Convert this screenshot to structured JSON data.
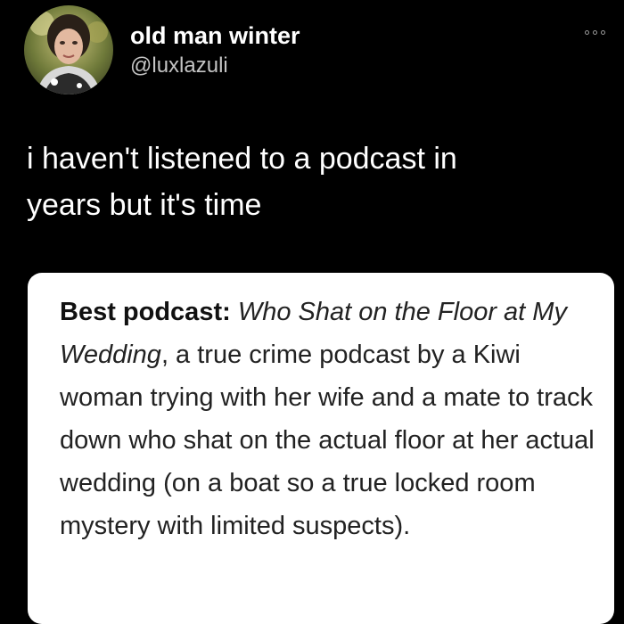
{
  "author": {
    "display_name": "old man winter",
    "handle": "@luxlazuli",
    "avatar_icon": "profile-photo"
  },
  "more_icon": "more-options-icon",
  "tweet": {
    "text_line_1": "i haven't listened to a podcast in",
    "text_line_2": "years but it's time"
  },
  "card": {
    "label": "Best podcast:",
    "title": "Who Shat on the Floor at My Wedding",
    "rest": ", a true crime podcast by a Kiwi woman trying with her wife and a mate to track down who shat on the actual floor at her actual wedding (on a boat so a true locked room mystery with limited suspects)."
  },
  "colors": {
    "background": "#000000",
    "text": "#ffffff",
    "handle": "#c4c4c4",
    "card_background": "#ffffff",
    "card_text": "#222222"
  }
}
